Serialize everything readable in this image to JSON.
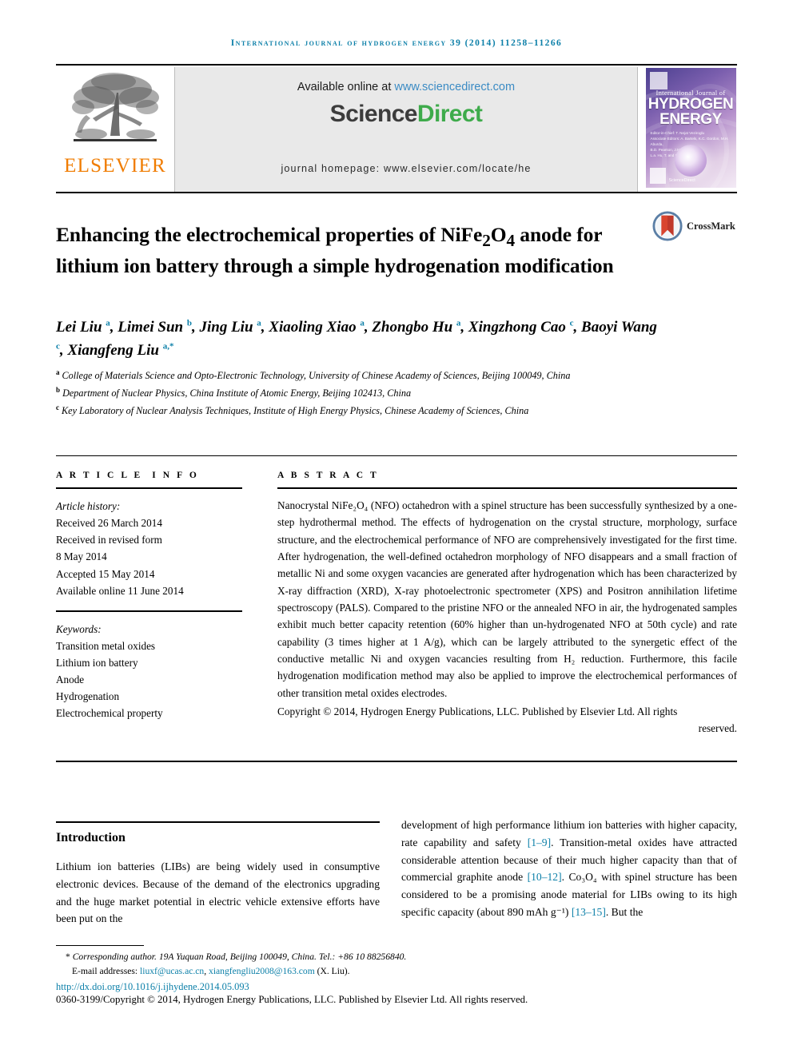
{
  "running_head": "International Journal of Hydrogen Energy 39 (2014) 11258–11266",
  "masthead": {
    "publisher_name": "ELSEVIER",
    "available_prefix": "Available online at ",
    "available_url": "www.sciencedirect.com",
    "sciencedirect_part1": "Science",
    "sciencedirect_part2": "Direct",
    "journal_homepage": "journal homepage: www.elsevier.com/locate/he",
    "cover": {
      "line_intl": "International Journal of",
      "line_title1": "HYDROGEN",
      "line_title2": "ENERGY",
      "editors": "Editor-in-Chief:  T. Nejat Veziroglu\nAssociate Editors:  A. Bartels, K.C. Gordon, M.H. Aburda,\nB.D. Pearson, J.M. Bradley,\nL.a. Hu, T. and K.C. Vedanathan",
      "footer_label": "ScienceDirect"
    }
  },
  "title": "Enhancing the electrochemical properties of NiFe₂O₄ anode for lithium ion battery through a simple hydrogenation modification",
  "crossmark_label": "CrossMark",
  "authors": [
    {
      "name": "Lei Liu",
      "sup": "a",
      "sep": ", "
    },
    {
      "name": "Limei Sun",
      "sup": "b",
      "sep": ", "
    },
    {
      "name": "Jing Liu",
      "sup": "a",
      "sep": ", "
    },
    {
      "name": "Xiaoling Xiao",
      "sup": "a",
      "sep": ", "
    },
    {
      "name": "Zhongbo Hu",
      "sup": "a",
      "sep": ", "
    },
    {
      "name": "Xingzhong Cao",
      "sup": "c",
      "sep": ", "
    },
    {
      "name": "Baoyi Wang",
      "sup": "c",
      "sep": ", "
    },
    {
      "name": "Xiangfeng Liu",
      "sup": "a,*",
      "sep": ""
    }
  ],
  "affiliations": [
    {
      "sup": "a",
      "text": "College of Materials Science and Opto-Electronic Technology, University of Chinese Academy of Sciences, Beijing 100049, China"
    },
    {
      "sup": "b",
      "text": "Department of Nuclear Physics, China Institute of Atomic Energy, Beijing 102413, China"
    },
    {
      "sup": "c",
      "text": "Key Laboratory of Nuclear Analysis Techniques, Institute of High Energy Physics, Chinese Academy of Sciences, China"
    }
  ],
  "article_info": {
    "heading": "ARTICLE INFO",
    "history_label": "Article history:",
    "history": [
      "Received 26 March 2014",
      "Received in revised form",
      "8 May 2014",
      "Accepted 15 May 2014",
      "Available online 11 June 2014"
    ],
    "keywords_label": "Keywords:",
    "keywords": [
      "Transition metal oxides",
      "Lithium ion battery",
      "Anode",
      "Hydrogenation",
      "Electrochemical property"
    ]
  },
  "abstract": {
    "heading": "ABSTRACT",
    "body": "Nanocrystal NiFe₂O₄ (NFO) octahedron with a spinel structure has been successfully synthesized by a one-step hydrothermal method. The effects of hydrogenation on the crystal structure, morphology, surface structure, and the electrochemical performance of NFO are comprehensively investigated for the first time. After hydrogenation, the well-defined octahedron morphology of NFO disappears and a small fraction of metallic Ni and some oxygen vacancies are generated after hydrogenation which has been characterized by X-ray diffraction (XRD), X-ray photoelectronic spectrometer (XPS) and Positron annihilation lifetime spectroscopy (PALS). Compared to the pristine NFO or the annealed NFO in air, the hydrogenated samples exhibit much better capacity retention (60% higher than un-hydrogenated NFO at 50th cycle) and rate capability (3 times higher at 1 A/g), which can be largely attributed to the synergetic effect of the conductive metallic Ni and oxygen vacancies resulting from H₂ reduction. Furthermore, this facile hydrogenation modification method may also be applied to improve the electrochemical performances of other transition metal oxides electrodes.",
    "copyright_main": "Copyright © 2014, Hydrogen Energy Publications, LLC. Published by Elsevier Ltd. All rights",
    "copyright_last": "reserved."
  },
  "sections": {
    "introduction_title": "Introduction",
    "intro_left": "Lithium ion batteries (LIBs) are being widely used in consumptive electronic devices. Because of the demand of the electronics upgrading and the huge market potential in electric vehicle extensive efforts have been put on the",
    "intro_right_pre1": "development of high performance lithium ion batteries with higher capacity, rate capability and safety ",
    "intro_ref1": "[1–9]",
    "intro_right_pre2": ". Transition-metal oxides have attracted considerable attention because of their much higher capacity than that of commercial graphite anode ",
    "intro_ref2": "[10–12]",
    "intro_right_pre3": ". Co₃O₄ with spinel structure has been considered to be a promising anode material for LIBs owing to its high specific capacity (about 890 mAh g⁻¹) ",
    "intro_ref3": "[13–15]",
    "intro_right_pre4": ". But the"
  },
  "footer": {
    "corresponding": "Corresponding author. 19A Yuquan Road, Beijing 100049, China. Tel.: +86 10 88256840.",
    "email_label": "E-mail addresses: ",
    "email1": "liuxf@ucas.ac.cn",
    "email_sep": ", ",
    "email2": "xiangfengliu2008@163.com",
    "email_suffix": " (X. Liu).",
    "doi": "http://dx.doi.org/10.1016/j.ijhydene.2014.05.093",
    "issn_copyright": "0360-3199/Copyright © 2014, Hydrogen Energy Publications, LLC. Published by Elsevier Ltd. All rights reserved."
  },
  "colors": {
    "journal_blue": "#0b7fa8",
    "elsevier_orange": "#f07c00",
    "sciencedirect_green": "#3eab4b",
    "link_blue": "#3b8bc4"
  }
}
